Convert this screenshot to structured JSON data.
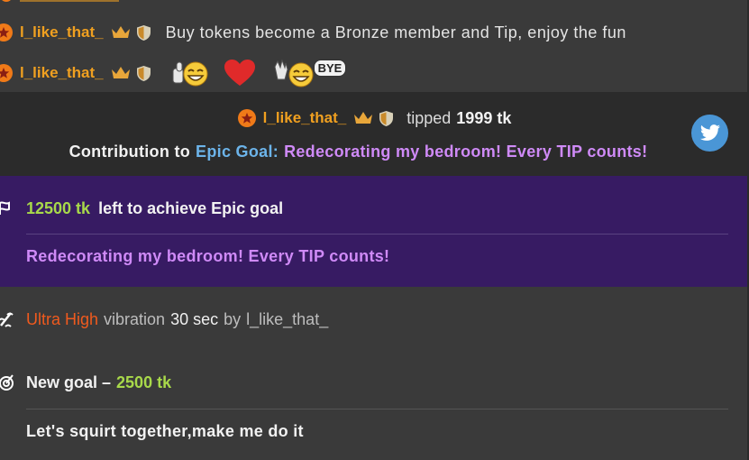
{
  "chat": {
    "row1": {
      "username": "l_like_that_",
      "message": "Buy tokens become a Bronze member and Tip, enjoy the fun"
    },
    "row2": {
      "username": "l_like_that_",
      "bye_label": "BYE"
    }
  },
  "tip": {
    "username": "l_like_that_",
    "tipped_word": "tipped",
    "amount": "1999 tk",
    "contribution_prefix": "Contribution to",
    "goal_kind": "Epic Goal:",
    "goal_title": "Redecorating my bedroom! Every TIP counts!"
  },
  "epic_goal": {
    "remaining": "12500 tk",
    "remaining_suffix": "left to achieve Epic goal",
    "title": "Redecorating my bedroom! Every TIP counts!"
  },
  "vibration": {
    "level": "Ultra High",
    "word": "vibration",
    "duration": "30 sec",
    "by_word": "by",
    "username": "l_like_that_"
  },
  "new_goal": {
    "label": "New goal –",
    "amount": "2500 tk",
    "description": "Let's squirt together,make me do it"
  },
  "colors": {
    "username": "#f0a020",
    "accent_green": "#a8d94a",
    "accent_purple": "#cf8af7",
    "accent_blue": "#6cb4ea",
    "accent_orange": "#f05a1e",
    "epic_panel_bg": "#371b63",
    "twitter_blue": "#4a96d6"
  },
  "icons": [
    "medal-icon",
    "crown-icon",
    "shield-icon",
    "thumbs-up-emoji-icon",
    "heart-icon",
    "wave-emoji-icon",
    "twitter-icon",
    "flag-icon",
    "vibration-icon",
    "goal-icon"
  ]
}
